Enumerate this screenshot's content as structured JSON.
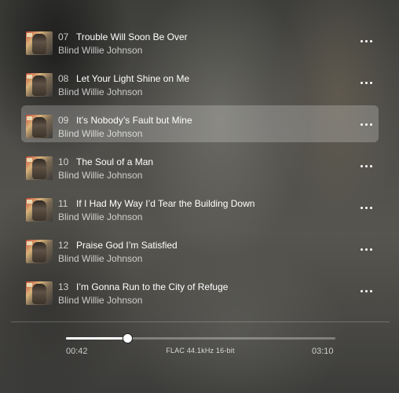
{
  "tracks": [
    {
      "number": "07",
      "title": "Trouble Will Soon Be Over",
      "artist": "Blind Willie Johnson",
      "selected": false
    },
    {
      "number": "08",
      "title": "Let Your Light Shine on Me",
      "artist": "Blind Willie Johnson",
      "selected": false
    },
    {
      "number": "09",
      "title": "It’s Nobody’s Fault but Mine",
      "artist": "Blind Willie Johnson",
      "selected": true
    },
    {
      "number": "10",
      "title": "The Soul of a Man",
      "artist": "Blind Willie Johnson",
      "selected": false
    },
    {
      "number": "11",
      "title": "If I Had My Way I’d Tear the Building Down",
      "artist": "Blind Willie Johnson",
      "selected": false
    },
    {
      "number": "12",
      "title": "Praise God I’m Satisfied",
      "artist": "Blind Willie Johnson",
      "selected": false
    },
    {
      "number": "13",
      "title": "I’m Gonna Run to the City of Refuge",
      "artist": "Blind Willie Johnson",
      "selected": false
    }
  ],
  "player": {
    "elapsed": "00:42",
    "total": "03:10",
    "format": "FLAC 44.1kHz 16-bit",
    "progress_fraction": 0.226
  },
  "icons": {
    "track_art": "album-art-icon",
    "more": "more-options-icon"
  },
  "colors": {
    "selected_row": "rgba(255,255,255,0.22)",
    "text_primary": "#ffffff",
    "progress_fill": "#ffffff"
  }
}
